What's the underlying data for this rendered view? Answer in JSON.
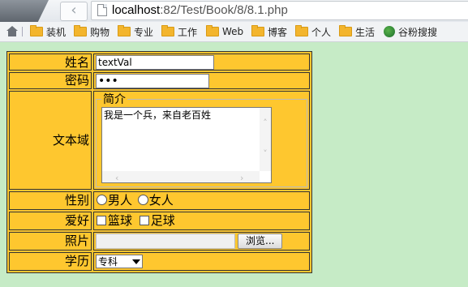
{
  "browser": {
    "url_host": "localhost",
    "url_path": ":82/Test/Book/8/8.1.php",
    "back_glyph": "‹"
  },
  "bookmarks": [
    {
      "label": "装机",
      "icon": "folder-icon"
    },
    {
      "label": "购物",
      "icon": "folder-icon"
    },
    {
      "label": "专业",
      "icon": "folder-icon"
    },
    {
      "label": "工作",
      "icon": "folder-icon"
    },
    {
      "label": "Web",
      "icon": "folder-icon"
    },
    {
      "label": "博客",
      "icon": "folder-icon"
    },
    {
      "label": "个人",
      "icon": "folder-icon"
    },
    {
      "label": "生活",
      "icon": "folder-icon"
    },
    {
      "label": "谷粉搜搜",
      "icon": "globe-icon"
    }
  ],
  "form": {
    "name_label": "姓名",
    "name_value": "textVal",
    "password_label": "密码",
    "password_value": "•••",
    "textarea_label": "文本域",
    "fieldset_legend": "简介",
    "textarea_value": "我是一个兵，来自老百姓",
    "gender_label": "性别",
    "gender_options": [
      "男人",
      "女人"
    ],
    "hobby_label": "爱好",
    "hobby_options": [
      "篮球",
      "足球"
    ],
    "photo_label": "照片",
    "browse_button": "浏览...",
    "education_label": "学历",
    "education_selected": "专科"
  },
  "colors": {
    "page_background": "#c6ebc6",
    "table_background": "#fec72f"
  }
}
